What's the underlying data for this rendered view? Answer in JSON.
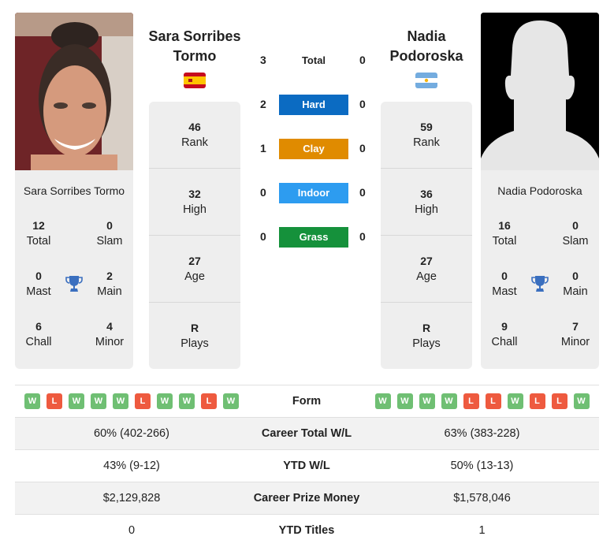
{
  "player1": {
    "name": "Sara Sorribes Tormo",
    "display_name_line1": "Sara Sorribes",
    "display_name_line2": "Tormo",
    "country": "Spain",
    "flag_colors": [
      "#c60b1e",
      "#ffc400",
      "#c60b1e"
    ],
    "photo_type": "player-photo",
    "titles": {
      "total": {
        "value": "12",
        "label": "Total"
      },
      "slam": {
        "value": "0",
        "label": "Slam"
      },
      "mast": {
        "value": "0",
        "label": "Mast"
      },
      "main": {
        "value": "2",
        "label": "Main"
      },
      "chall": {
        "value": "6",
        "label": "Chall"
      },
      "minor": {
        "value": "4",
        "label": "Minor"
      }
    },
    "rank": {
      "value": "46",
      "label": "Rank"
    },
    "high": {
      "value": "32",
      "label": "High"
    },
    "age": {
      "value": "27",
      "label": "Age"
    },
    "plays": {
      "value": "R",
      "label": "Plays"
    }
  },
  "player2": {
    "name": "Nadia Podoroska",
    "display_name_line1": "Nadia",
    "display_name_line2": "Podoroska",
    "country": "Argentina",
    "flag_colors": [
      "#74acdf",
      "#ffffff",
      "#74acdf"
    ],
    "photo_type": "silhouette-placeholder",
    "titles": {
      "total": {
        "value": "16",
        "label": "Total"
      },
      "slam": {
        "value": "0",
        "label": "Slam"
      },
      "mast": {
        "value": "0",
        "label": "Mast"
      },
      "main": {
        "value": "0",
        "label": "Main"
      },
      "chall": {
        "value": "9",
        "label": "Chall"
      },
      "minor": {
        "value": "7",
        "label": "Minor"
      }
    },
    "rank": {
      "value": "59",
      "label": "Rank"
    },
    "high": {
      "value": "36",
      "label": "High"
    },
    "age": {
      "value": "27",
      "label": "Age"
    },
    "plays": {
      "value": "R",
      "label": "Plays"
    }
  },
  "h2h": [
    {
      "surface": "Total",
      "left": "3",
      "right": "0",
      "color": ""
    },
    {
      "surface": "Hard",
      "left": "2",
      "right": "0",
      "color": "#0b6bc2"
    },
    {
      "surface": "Clay",
      "left": "1",
      "right": "0",
      "color": "#e08b00"
    },
    {
      "surface": "Indoor",
      "left": "0",
      "right": "0",
      "color": "#2d9cf0"
    },
    {
      "surface": "Grass",
      "left": "0",
      "right": "0",
      "color": "#15913b"
    }
  ],
  "comparison": {
    "form": {
      "label": "Form",
      "left": [
        "W",
        "L",
        "W",
        "W",
        "W",
        "L",
        "W",
        "W",
        "L",
        "W"
      ],
      "right": [
        "W",
        "W",
        "W",
        "W",
        "L",
        "L",
        "W",
        "L",
        "L",
        "W"
      ]
    },
    "rows": [
      {
        "label": "Career Total W/L",
        "left": "60% (402-266)",
        "right": "63% (383-228)"
      },
      {
        "label": "YTD W/L",
        "left": "43% (9-12)",
        "right": "50% (13-13)"
      },
      {
        "label": "Career Prize Money",
        "left": "$2,129,828",
        "right": "$1,578,046"
      },
      {
        "label": "YTD Titles",
        "left": "0",
        "right": "1"
      }
    ]
  },
  "colors": {
    "win": "#6fbf73",
    "loss": "#ee5a3f",
    "trophy": "#3a6fbf",
    "card_bg": "#eeeeee"
  }
}
